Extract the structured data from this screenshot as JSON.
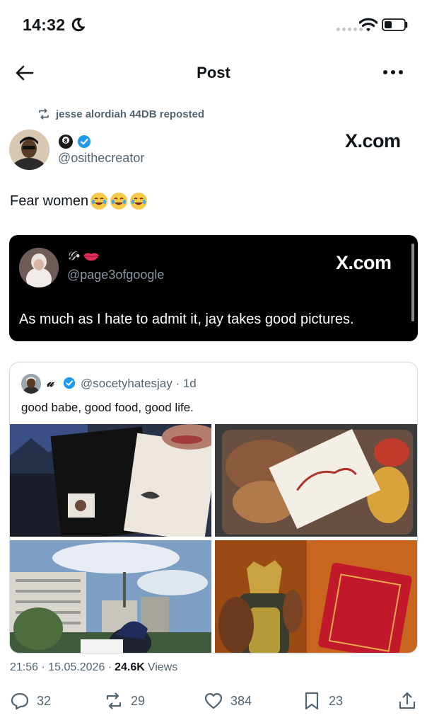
{
  "status_bar": {
    "time": "14:32"
  },
  "nav": {
    "title": "Post"
  },
  "repost": {
    "text": "jesse alordiah 44DB reposted"
  },
  "author": {
    "handle": "@osithecreator"
  },
  "watermark": "X.com",
  "tweet": {
    "text": "Fear women"
  },
  "embedded": {
    "name": "𝒢•",
    "handle": "@page3ofgoogle",
    "watermark": "X.com",
    "text": "As much as I hate to admit it, jay takes good pictures."
  },
  "quote": {
    "name": "𝓊",
    "handle": "@socetyhatesjay · 1d",
    "text": "good babe, good food, good life."
  },
  "meta": {
    "datetime": "21:56 · 15.05.2026 ·",
    "views_count": "24.6K",
    "views_label": "Views"
  },
  "actions": {
    "replies": "32",
    "reposts": "29",
    "likes": "384",
    "bookmarks": "23"
  },
  "colors": {
    "verified": "#1d9bf0",
    "muted": "#536471",
    "text": "#0f1419"
  }
}
